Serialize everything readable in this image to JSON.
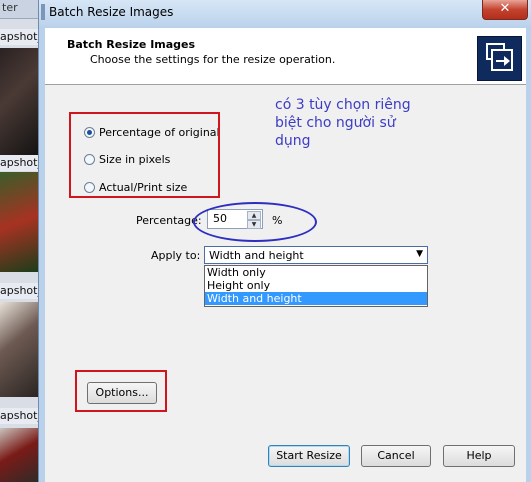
{
  "background": {
    "top_label": "ter",
    "snapshot_labels": [
      "apshot_",
      "apshot_",
      "apshot_",
      "apshot_",
      "apshot_"
    ]
  },
  "window": {
    "title": "Batch Resize Images",
    "close_symbol": "✕"
  },
  "header": {
    "title": "Batch Resize Images",
    "subtitle": "Choose the settings for the resize operation.",
    "icon": "resize-images-icon"
  },
  "options": {
    "percentage_label": "Percentage of original",
    "pixels_label": "Size in pixels",
    "actual_label": "Actual/Print size",
    "selected": "percentage"
  },
  "percentage": {
    "label": "Percentage:",
    "value": "50",
    "unit": "%"
  },
  "apply_to": {
    "label": "Apply to:",
    "selected": "Width and height",
    "options": [
      "Width only",
      "Height only",
      "Width and height"
    ]
  },
  "annotation": {
    "text": "có 3 tùy chọn riêng\nbiệt cho người sử\ndụng"
  },
  "buttons": {
    "options": "Options...",
    "start": "Start Resize",
    "cancel": "Cancel",
    "help": "Help"
  },
  "colors": {
    "annotation_red": "#d1151e",
    "annotation_blue": "#2e2ec0",
    "selection": "#3399ff",
    "header_icon_bg": "#0f2a5c"
  }
}
